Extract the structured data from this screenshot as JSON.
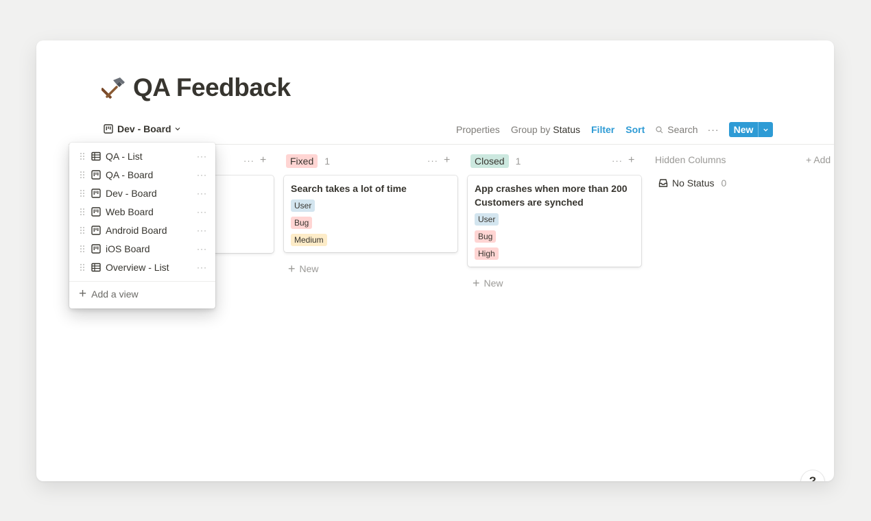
{
  "page": {
    "title": "QA Feedback",
    "icon": "hammer-icon"
  },
  "view_switcher": {
    "label": "Dev - Board",
    "icon": "board-icon"
  },
  "toolbar": {
    "properties": "Properties",
    "group_by_prefix": "Group by",
    "group_by_value": "Status",
    "filter": "Filter",
    "sort": "Sort",
    "search": "Search",
    "more": "···",
    "new": "New"
  },
  "columns": [
    {
      "name": "Fixed",
      "count": "1",
      "color": "#ffd5d3",
      "cards": [
        {
          "title": "Search takes a lot of time",
          "tags": [
            "User",
            "Bug",
            "Medium"
          ]
        }
      ],
      "new_label": "New"
    },
    {
      "name": "Closed",
      "count": "1",
      "color": "#cce8df",
      "cards": [
        {
          "title": "App crashes when more than 200 Customers are synched",
          "tags": [
            "User",
            "Bug",
            "High"
          ]
        }
      ],
      "new_label": "New"
    }
  ],
  "hidden_columns": {
    "label": "Hidden Columns",
    "no_status": "No Status",
    "no_status_count": "0"
  },
  "add_group": "+ Add",
  "help": "?",
  "views_menu": {
    "items": [
      {
        "label": "QA - List",
        "icon": "table-icon"
      },
      {
        "label": "QA - Board",
        "icon": "board-icon"
      },
      {
        "label": "Dev - Board",
        "icon": "board-icon"
      },
      {
        "label": "Web Board",
        "icon": "board-icon"
      },
      {
        "label": "Android Board",
        "icon": "board-icon"
      },
      {
        "label": "iOS Board",
        "icon": "board-icon"
      },
      {
        "label": "Overview - List",
        "icon": "table-icon"
      }
    ],
    "add_view": "Add a view"
  }
}
